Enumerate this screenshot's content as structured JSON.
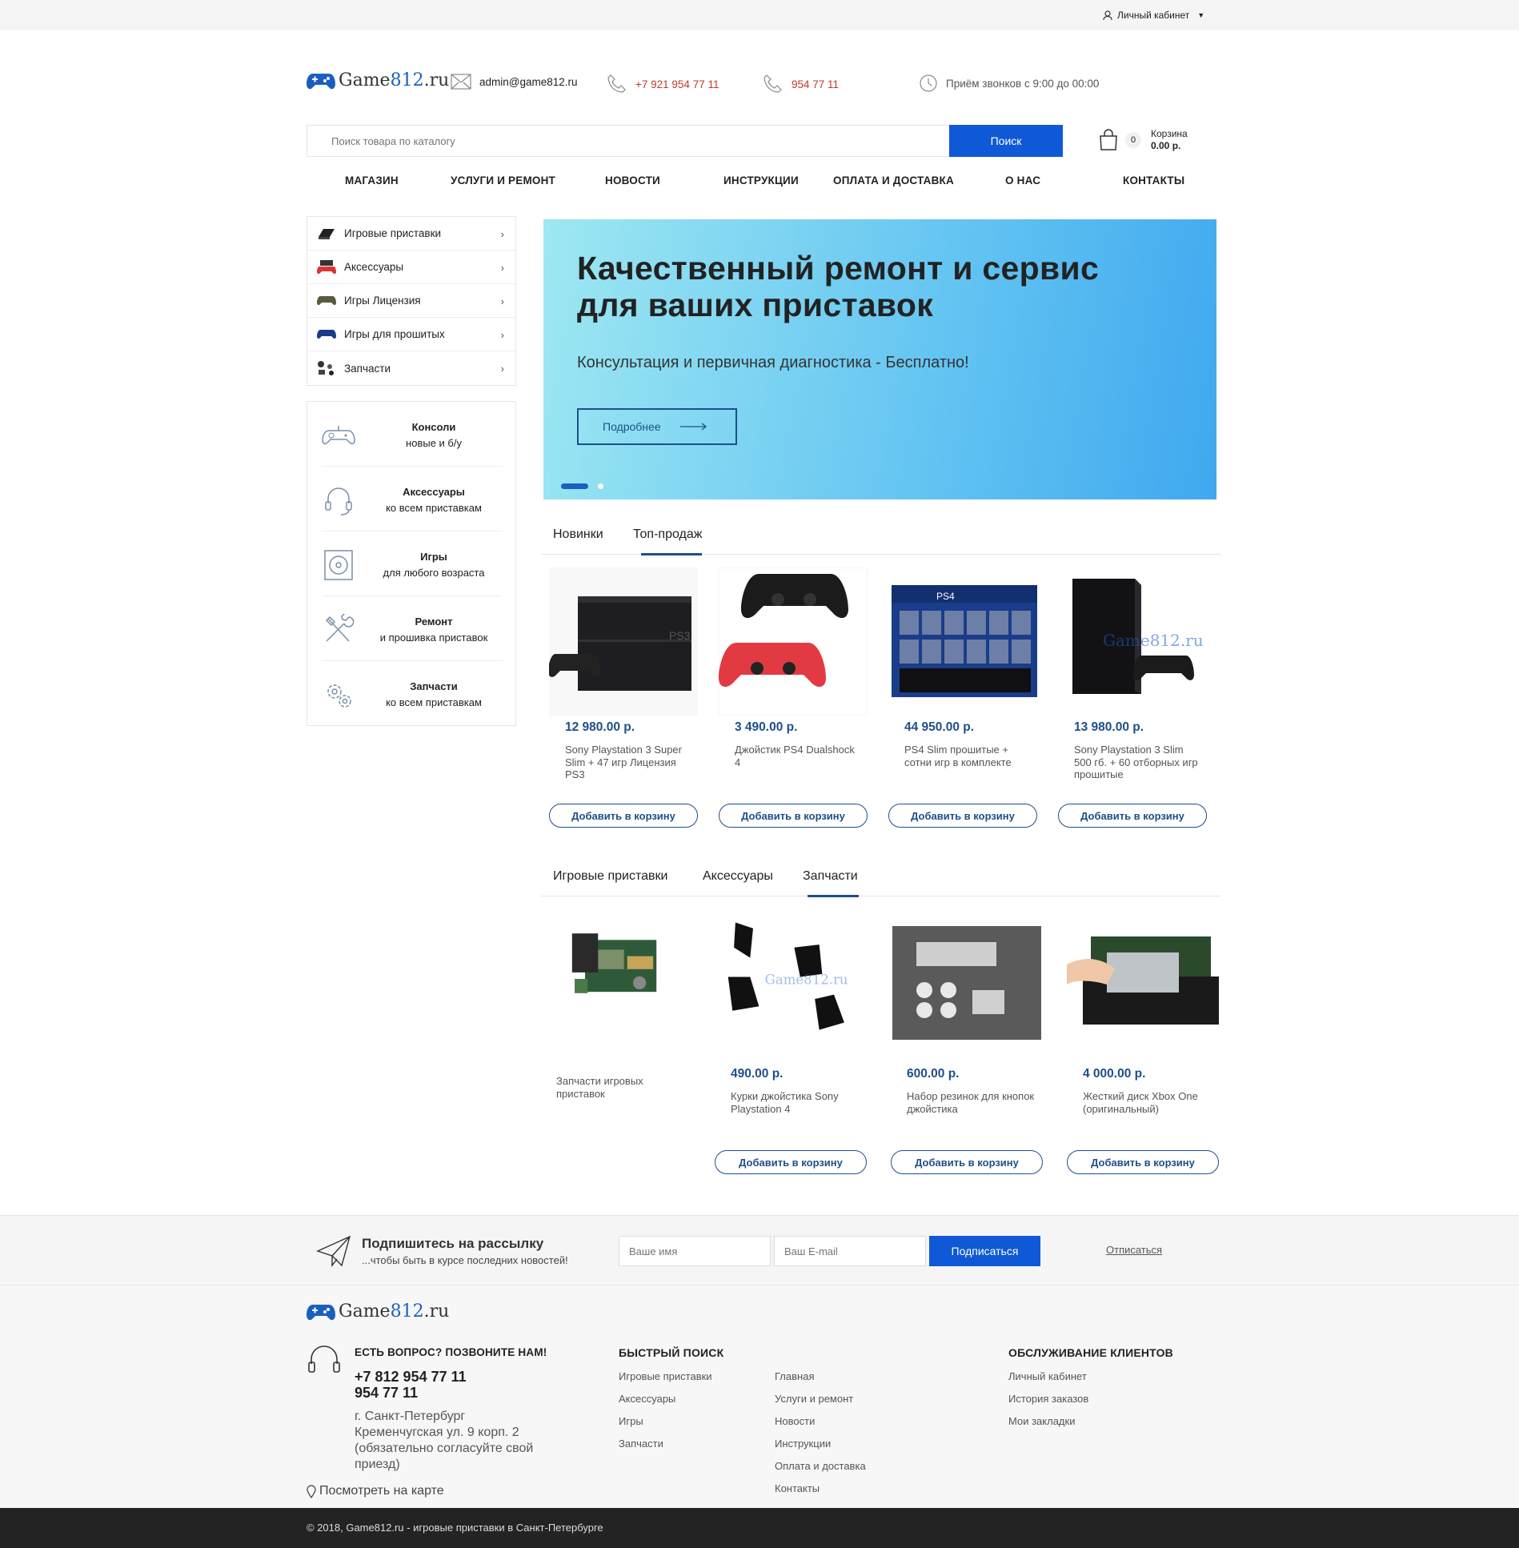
{
  "topbar": {
    "account_label": "Личный кабинет"
  },
  "header": {
    "logo_prefix": "Game",
    "logo_accent": "812",
    "logo_suffix": ".ru",
    "email": "admin@game812.ru",
    "phone1": "+7 921 954 77 11",
    "phone2": "954 77 11",
    "hours": "Приём звонков с 9:00 до 00:00"
  },
  "search": {
    "placeholder": "Поиск товара по каталогу",
    "button": "Поиск"
  },
  "cart": {
    "count": "0",
    "label": "Корзина",
    "total": "0.00 р."
  },
  "nav": [
    "МАГАЗИН",
    "УСЛУГИ И РЕМОНТ",
    "НОВОСТИ",
    "ИНСТРУКЦИИ",
    "ОПЛАТА И ДОСТАВКА",
    "О НАС",
    "КОНТАКТЫ"
  ],
  "categories": [
    {
      "label": "Игровые приставки",
      "icon": "console-icon"
    },
    {
      "label": "Аксессуары",
      "icon": "gamepad-icon"
    },
    {
      "label": "Игры Лицензия",
      "icon": "gamepad-icon"
    },
    {
      "label": "Игры для прошитых",
      "icon": "gamepad-icon"
    },
    {
      "label": "Запчасти",
      "icon": "parts-icon"
    }
  ],
  "features": [
    {
      "title": "Консоли",
      "subtitle": "новые и б/у",
      "icon": "gamepad-icon"
    },
    {
      "title": "Аксессуары",
      "subtitle": "ко всем приставкам",
      "icon": "headset-icon"
    },
    {
      "title": "Игры",
      "subtitle": "для любого возраста",
      "icon": "disc-icon"
    },
    {
      "title": "Ремонт",
      "subtitle": "и прошивка приставок",
      "icon": "tools-icon"
    },
    {
      "title": "Запчасти",
      "subtitle": "ко всем приставкам",
      "icon": "gear-icon"
    }
  ],
  "banner": {
    "title_line1": "Качественный ремонт и сервис",
    "title_line2": "для ваших приставок",
    "subtitle": "Консультация и первичная диагностика - Бесплатно!",
    "button": "Подробнее"
  },
  "tabs1": {
    "items": [
      "Новинки",
      "Топ-продаж"
    ],
    "active": 1
  },
  "products1": [
    {
      "price": "12 980.00 р.",
      "name": "Sony Playstation 3 Super Slim + 47 игр Лицензия PS3",
      "button": "Добавить в корзину"
    },
    {
      "price": "3 490.00 р.",
      "name": "Джойстик PS4 Dualshock 4",
      "button": "Добавить в корзину"
    },
    {
      "price": "44 950.00 р.",
      "name": "PS4 Slim прошитые + сотни игр в комплекте",
      "button": "Добавить в корзину"
    },
    {
      "price": "13 980.00 р.",
      "name": "Sony Playstation 3 Slim 500 гб. + 60 отборных игр прошитые",
      "button": "Добавить в корзину"
    }
  ],
  "tabs2": {
    "items": [
      "Игровые приставки",
      "Аксессуары",
      "Запчасти"
    ],
    "active": 2
  },
  "products2": [
    {
      "price": "",
      "name": "Запчасти игровых приставок",
      "button": ""
    },
    {
      "price": "490.00 р.",
      "name": "Курки джойстика Sony Playstation 4",
      "button": "Добавить в корзину"
    },
    {
      "price": "600.00 р.",
      "name": "Набор резинок для кнопок джойстика",
      "button": "Добавить в корзину"
    },
    {
      "price": "4 000.00 р.",
      "name": "Жесткий диск Xbox One (оригинальный)",
      "button": "Добавить в корзину"
    }
  ],
  "subscribe": {
    "title": "Подпишитесь на рассылку",
    "subtitle": "...чтобы быть в курсе последних новостей!",
    "name_placeholder": "Ваше имя",
    "email_placeholder": "Ваш E-mail",
    "button": "Подписаться",
    "unsubscribe": "Отписаться"
  },
  "footer": {
    "question": "ЕСТЬ ВОПРОС? ПОЗВОНИТЕ НАМ!",
    "phone1": "+7 812 954 77 11",
    "phone2": "954 77 11",
    "address_line1": "г. Санкт-Петербург",
    "address_line2": "Кременчугская ул. 9 корп. 2",
    "address_line3": "(обязательно согласуйте свой",
    "address_line4": "приезд)",
    "map_link": "Посмотреть на карте",
    "quick_title": "БЫСТРЫЙ ПОИСК",
    "quick_col1": [
      "Игровые приставки",
      "Аксессуары",
      "Игры",
      "Запчасти"
    ],
    "quick_col2": [
      "Главная",
      "Услуги и ремонт",
      "Новости",
      "Инструкции",
      "Оплата и доставка",
      "Контакты"
    ],
    "service_title": "ОБСЛУЖИВАНИЕ КЛИЕНТОВ",
    "service_links": [
      "Личный кабинет",
      "История заказов",
      "Мои закладки"
    ],
    "copyright": "© 2018, Game812.ru - игровые приставки в Санкт-Петербурге"
  },
  "colors": {
    "accent": "#1059d6",
    "dark_blue": "#1d4f8a",
    "phone_red": "#c0392b"
  }
}
